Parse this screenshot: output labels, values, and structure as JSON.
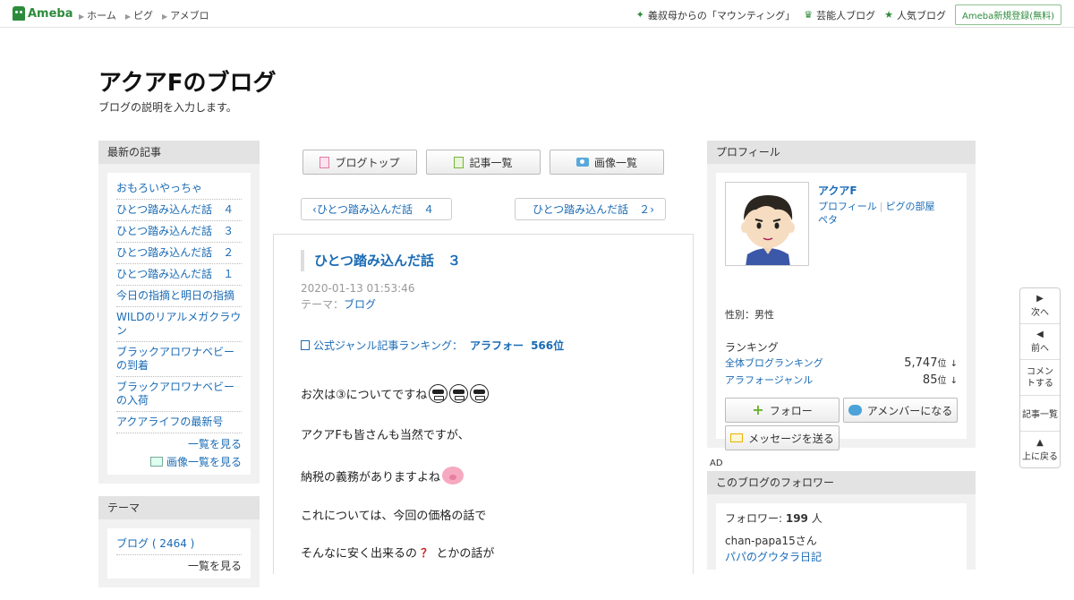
{
  "topbar": {
    "logo_text": "Ameba",
    "nav": [
      "ホーム",
      "ピグ",
      "アメブロ"
    ],
    "right_links": [
      {
        "icon": "sparkle-icon",
        "label": "義叔母からの「マウンティング」"
      },
      {
        "icon": "crown-icon",
        "label": "芸能人ブログ"
      },
      {
        "icon": "star-icon",
        "label": "人気ブログ"
      }
    ],
    "register_label": "Ameba新規登録(無料)"
  },
  "blog": {
    "title": "アクアFのブログ",
    "description": "ブログの説明を入力します。"
  },
  "left": {
    "recent_title": "最新の記事",
    "recent": [
      "おもろいやっちゃ",
      "ひとつ踏み込んだ話　４",
      "ひとつ踏み込んだ話　３",
      "ひとつ踏み込んだ話　２",
      "ひとつ踏み込んだ話　１",
      "今日の指摘と明日の指摘",
      "WILDのリアルメガクラウン",
      "ブラックアロワナベビーの到着",
      "ブラックアロワナベビーの入荷",
      "アクアライフの最新号"
    ],
    "see_list": "一覧を見る",
    "see_images": "画像一覧を見る",
    "theme_title": "テーマ",
    "theme_item": "ブログ ( 2464 )",
    "theme_more": "一覧を見る"
  },
  "main": {
    "buttons": [
      "ブログトップ",
      "記事一覧",
      "画像一覧"
    ],
    "prev_label": "ひとつ踏み込んだ話　４",
    "next_label": "ひとつ踏み込んだ話　２",
    "entry_title": "ひとつ踏み込んだ話　３",
    "date": "2020-01-13 01:53:46",
    "theme_prefix": "テーマ：",
    "theme_link": "ブログ",
    "ranking_prefix": "公式ジャンル記事ランキング：",
    "ranking_genre": "アラフォー",
    "ranking_rank": "566位",
    "p1": "お次は③についてですね",
    "p2": "アクアFも皆さんも当然ですが、",
    "p3": "納税の義務がありますよね",
    "p4": "これについては、今回の価格の話で",
    "p5a": "そんなに安く出来るの",
    "p5q": "？",
    "p5b": "とかの話が"
  },
  "profile": {
    "title": "プロフィール",
    "name": "アクアF",
    "link_profile": "プロフィール",
    "link_room": "ピグの部屋",
    "link_peta": "ペタ",
    "gender": "性別：男性",
    "ranking_title": "ランキング",
    "rank_all_label": "全体ブログランキング",
    "rank_all_value": "5,747",
    "rank_genre_label": "アラフォージャンル",
    "rank_genre_value": "85",
    "rank_unit": "位",
    "rank_arrow": "↓",
    "follow": "フォロー",
    "amember": "アメンバーになる",
    "message": "メッセージを送る"
  },
  "ad_label": "AD",
  "followers": {
    "title": "このブログのフォロワー",
    "count_prefix": "フォロワー: ",
    "count": "199",
    "count_suffix": " 人",
    "user": "chan-papa15さん",
    "blog": "パパのグウタラ日記"
  },
  "sidemenu": {
    "next": "次へ",
    "prev": "前へ",
    "comment": "コメントする",
    "list": "記事一覧",
    "top": "上に戻る"
  }
}
